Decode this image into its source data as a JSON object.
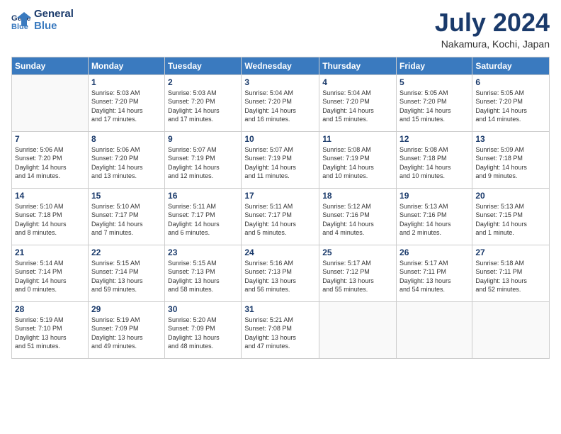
{
  "header": {
    "logo_line1": "General",
    "logo_line2": "Blue",
    "month": "July 2024",
    "location": "Nakamura, Kochi, Japan"
  },
  "weekdays": [
    "Sunday",
    "Monday",
    "Tuesday",
    "Wednesday",
    "Thursday",
    "Friday",
    "Saturday"
  ],
  "weeks": [
    [
      {
        "day": "",
        "info": ""
      },
      {
        "day": "1",
        "info": "Sunrise: 5:03 AM\nSunset: 7:20 PM\nDaylight: 14 hours\nand 17 minutes."
      },
      {
        "day": "2",
        "info": "Sunrise: 5:03 AM\nSunset: 7:20 PM\nDaylight: 14 hours\nand 17 minutes."
      },
      {
        "day": "3",
        "info": "Sunrise: 5:04 AM\nSunset: 7:20 PM\nDaylight: 14 hours\nand 16 minutes."
      },
      {
        "day": "4",
        "info": "Sunrise: 5:04 AM\nSunset: 7:20 PM\nDaylight: 14 hours\nand 15 minutes."
      },
      {
        "day": "5",
        "info": "Sunrise: 5:05 AM\nSunset: 7:20 PM\nDaylight: 14 hours\nand 15 minutes."
      },
      {
        "day": "6",
        "info": "Sunrise: 5:05 AM\nSunset: 7:20 PM\nDaylight: 14 hours\nand 14 minutes."
      }
    ],
    [
      {
        "day": "7",
        "info": "Sunrise: 5:06 AM\nSunset: 7:20 PM\nDaylight: 14 hours\nand 14 minutes."
      },
      {
        "day": "8",
        "info": "Sunrise: 5:06 AM\nSunset: 7:20 PM\nDaylight: 14 hours\nand 13 minutes."
      },
      {
        "day": "9",
        "info": "Sunrise: 5:07 AM\nSunset: 7:19 PM\nDaylight: 14 hours\nand 12 minutes."
      },
      {
        "day": "10",
        "info": "Sunrise: 5:07 AM\nSunset: 7:19 PM\nDaylight: 14 hours\nand 11 minutes."
      },
      {
        "day": "11",
        "info": "Sunrise: 5:08 AM\nSunset: 7:19 PM\nDaylight: 14 hours\nand 10 minutes."
      },
      {
        "day": "12",
        "info": "Sunrise: 5:08 AM\nSunset: 7:18 PM\nDaylight: 14 hours\nand 10 minutes."
      },
      {
        "day": "13",
        "info": "Sunrise: 5:09 AM\nSunset: 7:18 PM\nDaylight: 14 hours\nand 9 minutes."
      }
    ],
    [
      {
        "day": "14",
        "info": "Sunrise: 5:10 AM\nSunset: 7:18 PM\nDaylight: 14 hours\nand 8 minutes."
      },
      {
        "day": "15",
        "info": "Sunrise: 5:10 AM\nSunset: 7:17 PM\nDaylight: 14 hours\nand 7 minutes."
      },
      {
        "day": "16",
        "info": "Sunrise: 5:11 AM\nSunset: 7:17 PM\nDaylight: 14 hours\nand 6 minutes."
      },
      {
        "day": "17",
        "info": "Sunrise: 5:11 AM\nSunset: 7:17 PM\nDaylight: 14 hours\nand 5 minutes."
      },
      {
        "day": "18",
        "info": "Sunrise: 5:12 AM\nSunset: 7:16 PM\nDaylight: 14 hours\nand 4 minutes."
      },
      {
        "day": "19",
        "info": "Sunrise: 5:13 AM\nSunset: 7:16 PM\nDaylight: 14 hours\nand 2 minutes."
      },
      {
        "day": "20",
        "info": "Sunrise: 5:13 AM\nSunset: 7:15 PM\nDaylight: 14 hours\nand 1 minute."
      }
    ],
    [
      {
        "day": "21",
        "info": "Sunrise: 5:14 AM\nSunset: 7:14 PM\nDaylight: 14 hours\nand 0 minutes."
      },
      {
        "day": "22",
        "info": "Sunrise: 5:15 AM\nSunset: 7:14 PM\nDaylight: 13 hours\nand 59 minutes."
      },
      {
        "day": "23",
        "info": "Sunrise: 5:15 AM\nSunset: 7:13 PM\nDaylight: 13 hours\nand 58 minutes."
      },
      {
        "day": "24",
        "info": "Sunrise: 5:16 AM\nSunset: 7:13 PM\nDaylight: 13 hours\nand 56 minutes."
      },
      {
        "day": "25",
        "info": "Sunrise: 5:17 AM\nSunset: 7:12 PM\nDaylight: 13 hours\nand 55 minutes."
      },
      {
        "day": "26",
        "info": "Sunrise: 5:17 AM\nSunset: 7:11 PM\nDaylight: 13 hours\nand 54 minutes."
      },
      {
        "day": "27",
        "info": "Sunrise: 5:18 AM\nSunset: 7:11 PM\nDaylight: 13 hours\nand 52 minutes."
      }
    ],
    [
      {
        "day": "28",
        "info": "Sunrise: 5:19 AM\nSunset: 7:10 PM\nDaylight: 13 hours\nand 51 minutes."
      },
      {
        "day": "29",
        "info": "Sunrise: 5:19 AM\nSunset: 7:09 PM\nDaylight: 13 hours\nand 49 minutes."
      },
      {
        "day": "30",
        "info": "Sunrise: 5:20 AM\nSunset: 7:09 PM\nDaylight: 13 hours\nand 48 minutes."
      },
      {
        "day": "31",
        "info": "Sunrise: 5:21 AM\nSunset: 7:08 PM\nDaylight: 13 hours\nand 47 minutes."
      },
      {
        "day": "",
        "info": ""
      },
      {
        "day": "",
        "info": ""
      },
      {
        "day": "",
        "info": ""
      }
    ]
  ]
}
